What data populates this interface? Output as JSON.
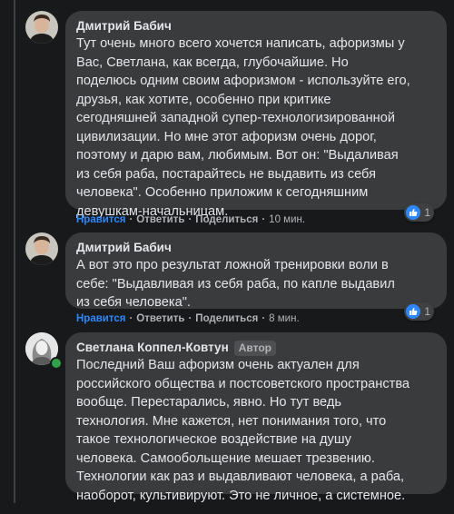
{
  "comments": [
    {
      "author": "Дмитрий Бабич",
      "text": "Тут очень много всего хочется написать, афоризмы у\nВас, Светлана, как всегда, глубочайшие. Но\nподелюсь одним своим афоризмом - используйте его,\nдрузья, как хотите, особенно при критике\nсегодняшней западной супер-технологизированной\nцивилизации. Но мне этот афоризм очень дорог,\nпоэтому и дарю вам, любимым. Вот он: \"Выдаливая\nиз себя раба, постарайтесь не выдавить из себя\nчеловека\". Особенно приложим к сегодняшним\nдевушкам-начальницам.",
      "actions": {
        "like": "Нравится",
        "reply": "Ответить",
        "share": "Поделиться",
        "time": "10 мин."
      },
      "reaction_count": "1"
    },
    {
      "author": "Дмитрий Бабич",
      "text": "А вот это про результат ложной тренировки воли в\nсебе: \"Выдавливая из себя раба, по капле выдавил\nиз себя человека\".",
      "actions": {
        "like": "Нравится",
        "reply": "Ответить",
        "share": "Поделиться",
        "time": "8 мин."
      },
      "reaction_count": "1"
    },
    {
      "author": "Светлана Коппел-Ковтун",
      "badge": "Автор",
      "text": "Последний Ваш афоризм очень актуален для\nроссийского общества и постсоветского пространства\nвообще. Перестарались, явно. Но тут ведь\nтехнология. Мне кажется, нет понимания того, что\nтакое технологическое воздействие на душу\nчеловека. Самообольщение мешает трезвению.\nТехнологии как раз и выдавливают человека, а раба,\nнаоборот, культивируют. Это не личное, а системное."
    }
  ],
  "separator": "·"
}
